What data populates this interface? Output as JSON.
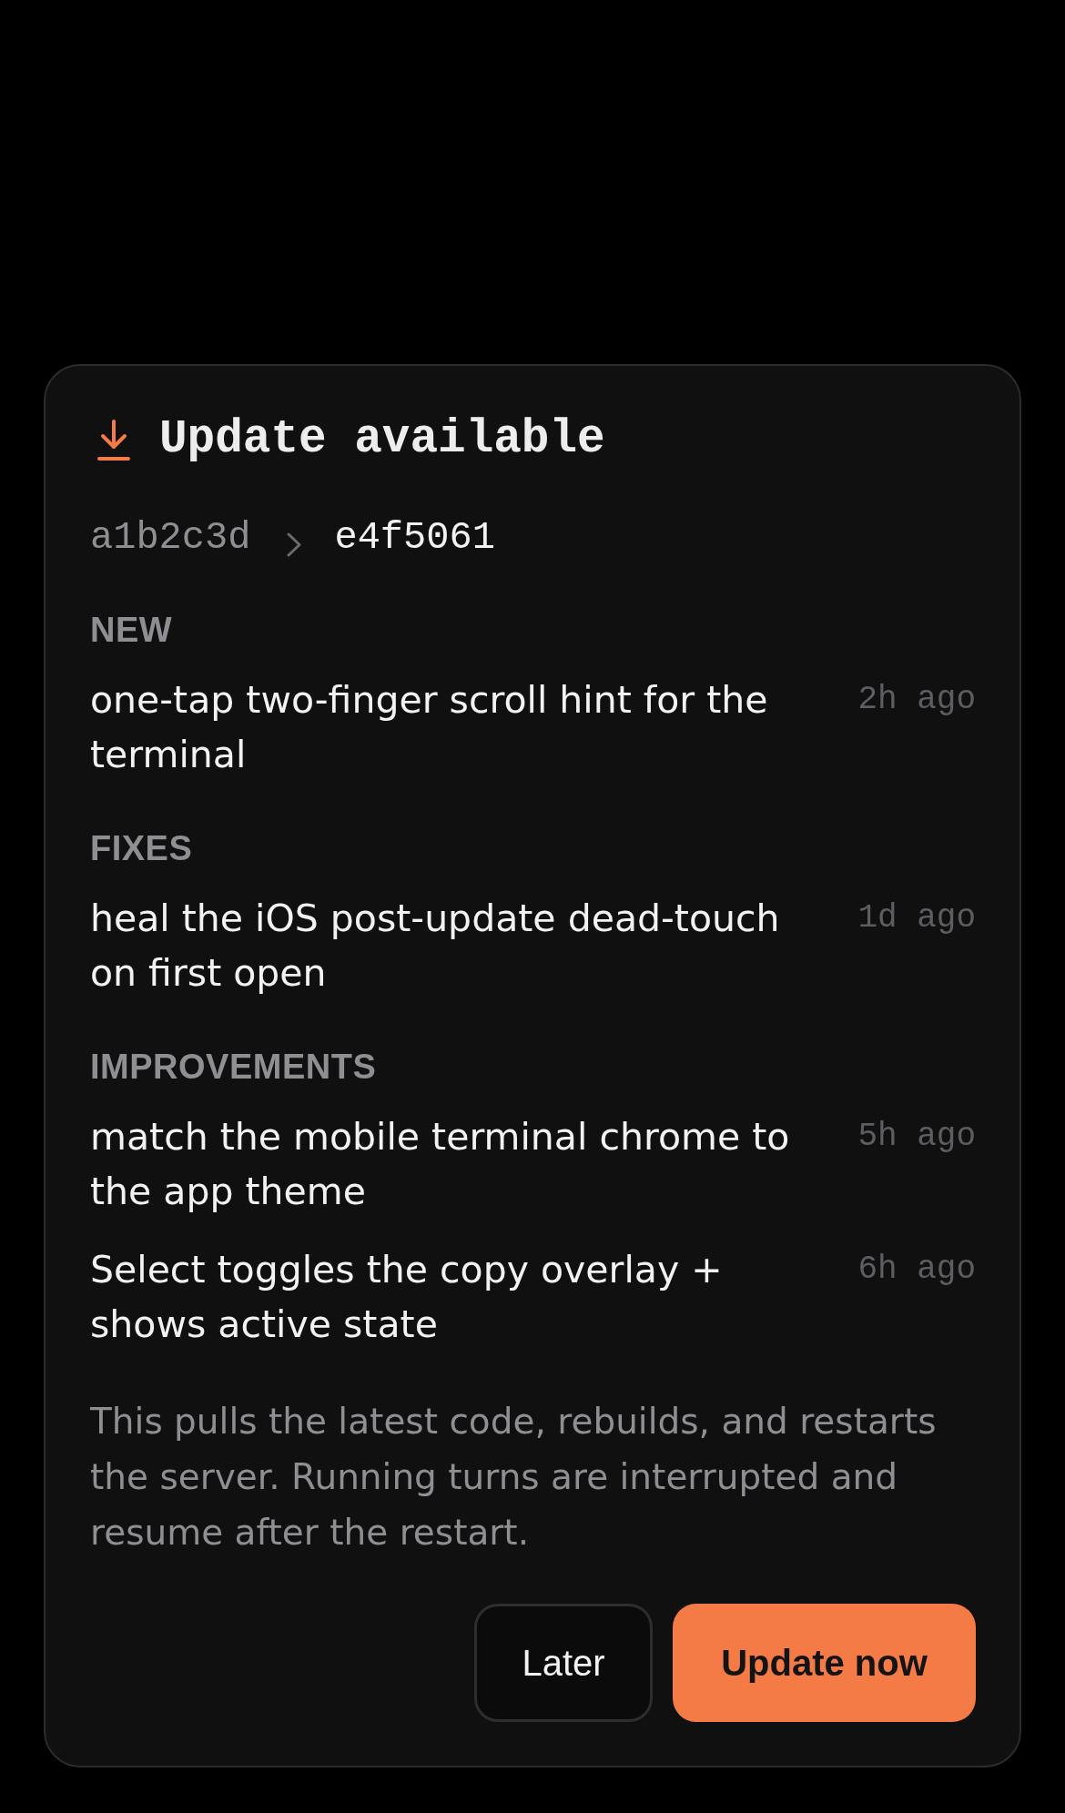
{
  "dialog": {
    "title": "Update available",
    "commits": {
      "from": "a1b2c3d",
      "to": "e4f5061"
    },
    "sections": [
      {
        "heading": "NEW",
        "items": [
          {
            "text": "one-tap two-finger scroll hint for the terminal",
            "time": "2h ago"
          }
        ]
      },
      {
        "heading": "FIXES",
        "items": [
          {
            "text": "heal the iOS post-update dead-touch on first open",
            "time": "1d ago"
          }
        ]
      },
      {
        "heading": "IMPROVEMENTS",
        "items": [
          {
            "text": "match the mobile terminal chrome to the app theme",
            "time": "5h ago"
          },
          {
            "text": "Select toggles the copy overlay + shows active state",
            "time": "6h ago"
          }
        ]
      }
    ],
    "note": "This pulls the latest code, rebuilds, and restarts the server. Running turns are interrupted and resume after the restart.",
    "buttons": [
      {
        "label": "Later",
        "kind": "secondary"
      },
      {
        "label": "Update now",
        "kind": "primary"
      }
    ]
  }
}
